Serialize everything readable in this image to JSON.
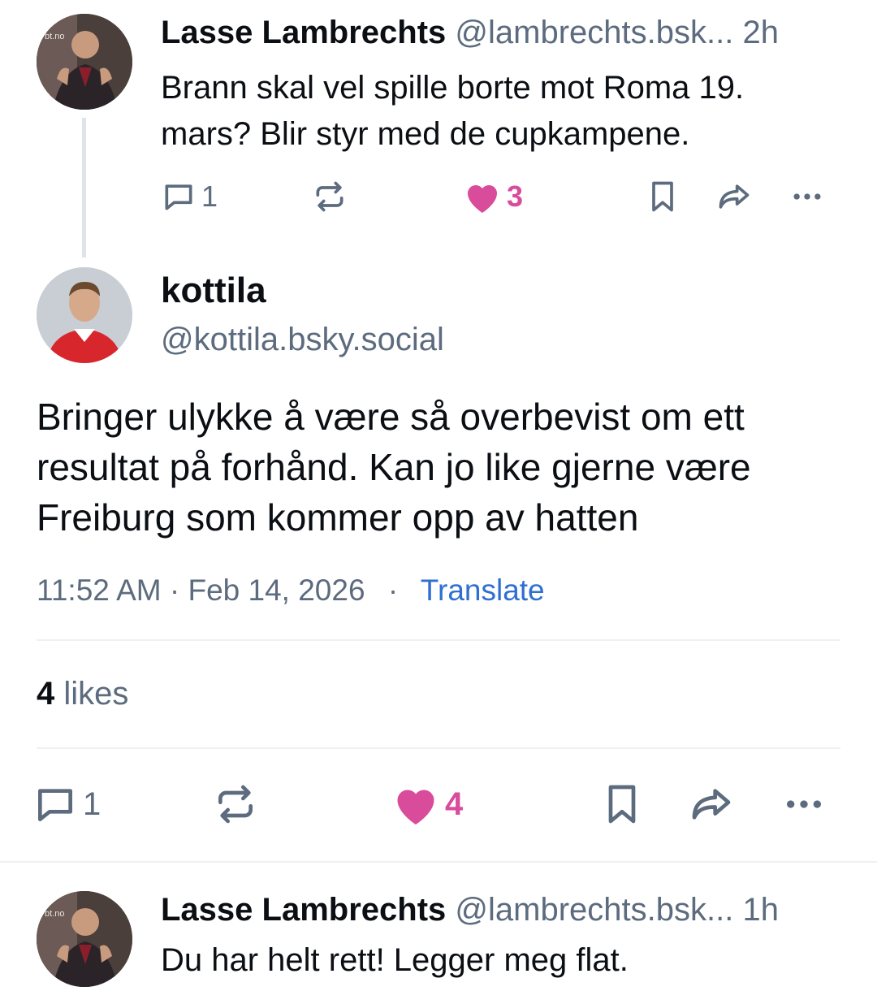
{
  "parent_post": {
    "author_name": "Lasse Lambrechts",
    "author_handle": "@lambrechts.bsk...",
    "time": "2h",
    "text_line1": "Brann skal vel spille borte mot Roma 19.",
    "text_line2": "mars? Blir styr med de cupkampene.",
    "avatar_watermark": "bt.no",
    "replies": "1",
    "likes": "3"
  },
  "main_post": {
    "author_name": "kottila",
    "author_handle": "@kottila.bsky.social",
    "text_line1": "Bringer ulykke å være så overbevist om ett",
    "text_line2": "resultat på forhånd. Kan jo like gjerne være",
    "text_line3": "Freiburg som kommer opp av hatten",
    "timestamp": "11:52 AM · Feb 14, 2026",
    "separator": "·",
    "translate_label": "Translate",
    "likes_count": "4",
    "likes_label": "likes",
    "replies": "1",
    "likes": "4"
  },
  "reply_post": {
    "author_name": "Lasse Lambrechts",
    "author_handle": "@lambrechts.bsk...",
    "time": "1h",
    "text": "Du har helt rett! Legger meg flat.",
    "avatar_watermark": "bt.no"
  },
  "colors": {
    "like": "#d94b9b",
    "link": "#2f6fd1",
    "muted": "#5c6b7e"
  }
}
